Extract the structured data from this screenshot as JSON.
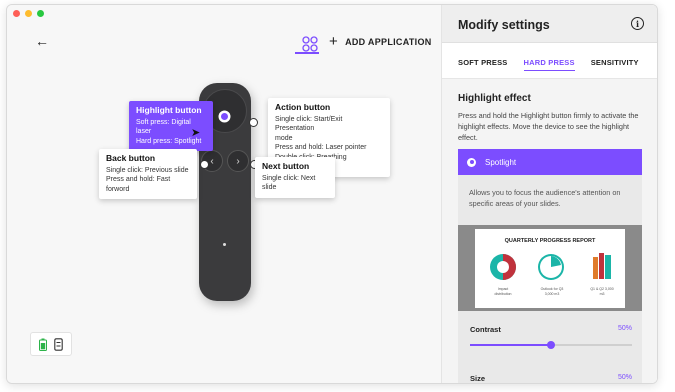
{
  "header": {
    "add_application_label": "ADD APPLICATION",
    "add_icon": "plus",
    "apps_icon": "apps-grid",
    "back_icon": "arrow-left"
  },
  "callouts": {
    "highlight": {
      "title": "Highlight button",
      "soft": "Soft press: Digital laser",
      "hard": "Hard press: Spotlight"
    },
    "action": {
      "title": "Action button",
      "line1": "Single click: Start/Exit Presentation",
      "line2": "mode",
      "line3": "Press and hold: Laser pointer",
      "line4": "Double click: Breathing Experience"
    },
    "back": {
      "title": "Back button",
      "line1": "Single click: Previous slide",
      "line2": "Press and hold: Fast forword"
    },
    "next": {
      "title": "Next button",
      "line1": "Single click: Next slide"
    }
  },
  "device_icons": [
    "battery-icon",
    "receiver-icon"
  ],
  "settings": {
    "title": "Modify settings",
    "info_icon": "i",
    "tabs": [
      {
        "label": "SOFT PRESS",
        "active": false
      },
      {
        "label": "HARD PRESS",
        "active": true
      },
      {
        "label": "SENSITIVITY",
        "active": false
      }
    ],
    "section_title": "Highlight effect",
    "section_desc": "Press and hold the Highlight button firmly to activate the highlight effects. Move the device to see the highlight effect.",
    "effect": {
      "name": "Spotlight",
      "selected": true,
      "desc": "Allows you to focus the audience's attention on specific areas of your slides."
    },
    "preview": {
      "slide_title": "QUARTERLY PROGRESS REPORT",
      "c1": "Impact distribution",
      "c2": "Outlook for Q3 3,000 m3",
      "c3": "Q1 & Q2 3,000 m3"
    },
    "contrast": {
      "label": "Contrast",
      "value_text": "50%",
      "value": 0.5
    },
    "size": {
      "label": "Size",
      "value_text": "50%"
    }
  },
  "colors": {
    "accent": "#7c4dff",
    "remote": "#3b3b3d"
  }
}
